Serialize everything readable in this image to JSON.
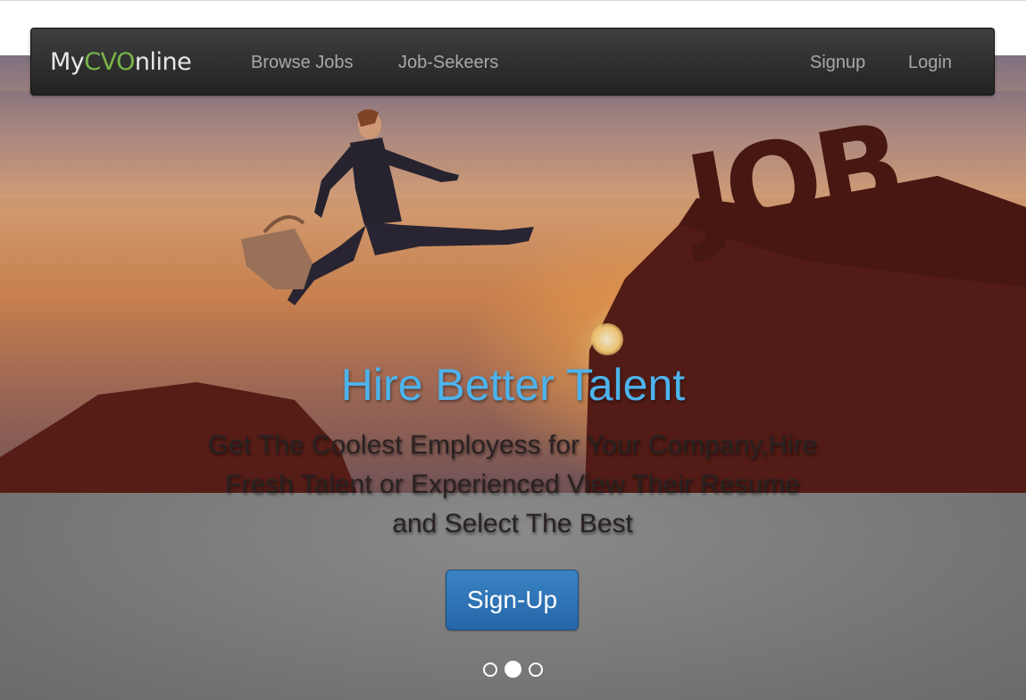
{
  "navbar": {
    "brand": {
      "part1": "My",
      "part2": "CVO",
      "part3": "nline"
    },
    "links": [
      {
        "label": "Browse Jobs"
      },
      {
        "label": "Job-Sekeers"
      }
    ],
    "right_links": [
      {
        "label": "Signup"
      },
      {
        "label": "Login"
      }
    ]
  },
  "hero": {
    "image_text": "JOB",
    "headline": "Hire Better Talent",
    "subtext": "Get The Coolest Employess for Your Company,Hire Fresh Talent or Experienced View Their Resume and Select The Best",
    "cta_label": "Sign-Up"
  },
  "carousel": {
    "slide_count": 3,
    "active_index": 1
  },
  "colors": {
    "headline": "#4db3ec",
    "brand_accent": "#7ab648",
    "cta": "#2d71b5",
    "navbar": "#2a2a2a"
  }
}
